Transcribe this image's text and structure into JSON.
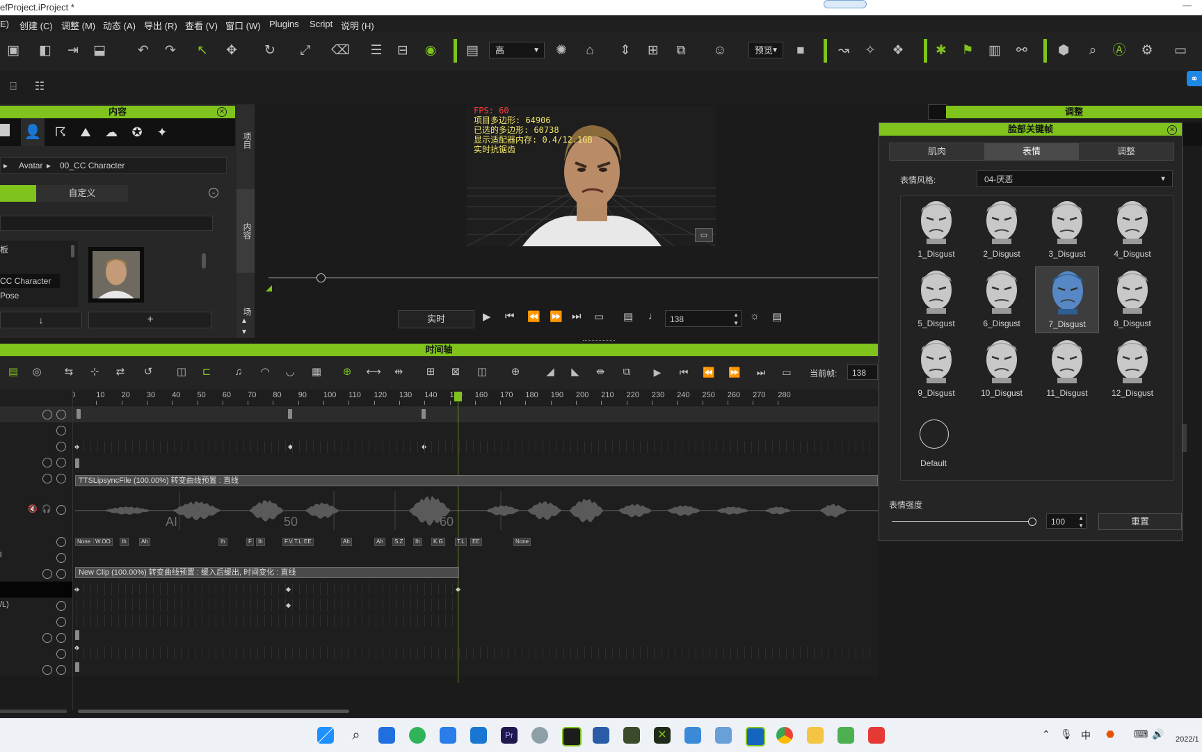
{
  "window": {
    "title": "efProject.iProject *"
  },
  "menu": [
    "E)",
    "创建 (C)",
    "调整 (M)",
    "动态 (A)",
    "导出 (R)",
    "查看 (V)",
    "窗口 (W)",
    "Plugins",
    "Script",
    "说明 (H)"
  ],
  "toolbar": {
    "quality_value": "高",
    "preview_value": "预览"
  },
  "content_panel": {
    "title": "内容",
    "breadcrumb": [
      "Avatar",
      "00_CC Character"
    ],
    "tabs": [
      "",
      "自定义"
    ],
    "tree": [
      "板",
      "CC Character",
      "Pose"
    ],
    "side_tabs": [
      "项目",
      "内容",
      "场"
    ]
  },
  "viewport": {
    "stats": [
      "FPS: 60",
      "项目多边形: 64906",
      "已选的多边形: 60738",
      "显示适配器内存: 0.4/12.1GB",
      "实时抗锯齿"
    ]
  },
  "playback": {
    "mode": "实时",
    "frame": "138"
  },
  "timeline": {
    "title": "时间轴",
    "current_frame_label": "当前帧:",
    "current_frame": "138",
    "ruler": [
      "0",
      "10",
      "20",
      "30",
      "40",
      "50",
      "60",
      "70",
      "80",
      "90",
      "100",
      "110",
      "120",
      "130",
      "140",
      "150",
      "160",
      "170",
      "180",
      "190",
      "200",
      "210",
      "220",
      "230",
      "240",
      "250",
      "260",
      "270",
      "280"
    ],
    "tts_clip": "TTSLipsyncFile (100.00%) 转变曲线预置 : 直线",
    "wave_labels": [
      "AI",
      "50",
      "60"
    ],
    "visemes": [
      "None",
      "W.OO",
      "Ih",
      "Ah",
      "Ih",
      "F",
      "Ih",
      "F.V",
      "T.L.D",
      "EE",
      "Ah",
      "Ah",
      "S.Z",
      "Ih",
      "K.G",
      "T.L",
      "EE",
      "None"
    ],
    "new_clip": "New Clip (100.00%) 转变曲线预置 : 缓入后缓出, 时间变化 : 直线",
    "row_labels": [
      "l",
      "/L)"
    ]
  },
  "right_panel": {
    "outer_title": "调整",
    "title": "脸部关键帧",
    "tabs": [
      "肌肉",
      "表情",
      "调整"
    ],
    "style_label": "表情风格:",
    "style_value": "04-厌恶",
    "expressions": [
      "1_Disgust",
      "2_Disgust",
      "3_Disgust",
      "4_Disgust",
      "5_Disgust",
      "6_Disgust",
      "7_Disgust",
      "8_Disgust",
      "9_Disgust",
      "10_Disgust",
      "11_Disgust",
      "12_Disgust"
    ],
    "selected_expression": "7_Disgust",
    "default_label": "Default",
    "strength_label": "表情强度",
    "strength_value": "100",
    "strength_fraction": 1.0,
    "reset_label": "重置"
  },
  "taskbar": {
    "tray": [
      "中"
    ],
    "clock": "2022/1"
  },
  "colors": {
    "accent": "#7fc31c",
    "selected_face": "#4a7fb5"
  }
}
